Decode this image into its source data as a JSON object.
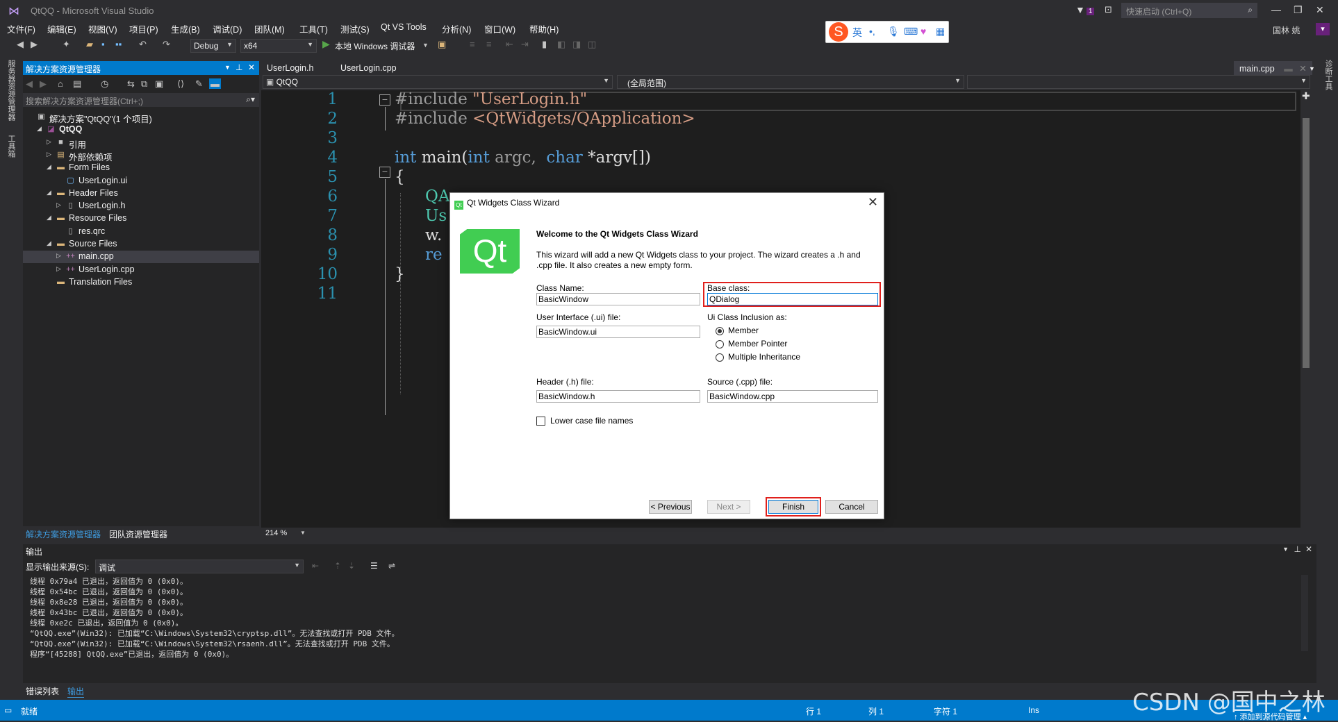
{
  "window": {
    "title": "QtQQ - Microsoft Visual Studio",
    "quick_launch": "快速启动 (Ctrl+Q)",
    "user": "国林 姚",
    "notif_count": "1"
  },
  "menu": [
    "文件(F)",
    "编辑(E)",
    "视图(V)",
    "项目(P)",
    "生成(B)",
    "调试(D)",
    "团队(M)",
    "工具(T)",
    "测试(S)",
    "Qt VS Tools",
    "分析(N)",
    "窗口(W)",
    "帮助(H)"
  ],
  "ime": {
    "mode": "英"
  },
  "toolbar": {
    "config": "Debug",
    "platform": "x64",
    "run_label": "本地 Windows 调试器"
  },
  "leftstrip": [
    "服务器资源管理器",
    "工具箱"
  ],
  "rightstrip": [
    "诊断工具"
  ],
  "solution": {
    "header": "解决方案资源管理器",
    "search_placeholder": "搜索解决方案资源管理器(Ctrl+;)",
    "tree": [
      {
        "label": "解决方案\"QtQQ\"(1 个项目)",
        "indent": 0,
        "arrow": "",
        "icon": "solution-icon"
      },
      {
        "label": "QtQQ",
        "indent": 1,
        "arrow": "◢",
        "icon": "project-icon",
        "bold": true
      },
      {
        "label": "引用",
        "indent": 2,
        "arrow": "▷",
        "icon": "references-icon"
      },
      {
        "label": "外部依赖项",
        "indent": 2,
        "arrow": "▷",
        "icon": "external-deps-icon"
      },
      {
        "label": "Form Files",
        "indent": 2,
        "arrow": "◢",
        "icon": "folder-icon"
      },
      {
        "label": "UserLogin.ui",
        "indent": 3,
        "arrow": "",
        "icon": "ui-file-icon"
      },
      {
        "label": "Header Files",
        "indent": 2,
        "arrow": "◢",
        "icon": "folder-icon"
      },
      {
        "label": "UserLogin.h",
        "indent": 3,
        "arrow": "▷",
        "icon": "header-file-icon"
      },
      {
        "label": "Resource Files",
        "indent": 2,
        "arrow": "◢",
        "icon": "folder-icon"
      },
      {
        "label": "res.qrc",
        "indent": 3,
        "arrow": "",
        "icon": "file-icon"
      },
      {
        "label": "Source Files",
        "indent": 2,
        "arrow": "◢",
        "icon": "folder-icon"
      },
      {
        "label": "main.cpp",
        "indent": 3,
        "arrow": "▷",
        "icon": "cpp-file-icon",
        "selected": true
      },
      {
        "label": "UserLogin.cpp",
        "indent": 3,
        "arrow": "▷",
        "icon": "cpp-file-icon"
      },
      {
        "label": "Translation Files",
        "indent": 2,
        "arrow": "",
        "icon": "folder-icon"
      }
    ],
    "tab_active": "解决方案资源管理器",
    "tab_other": "团队资源管理器"
  },
  "editor": {
    "tabs": [
      "UserLogin.h",
      "UserLogin.cpp"
    ],
    "active_tab": "main.cpp",
    "nav_project": "QtQQ",
    "nav_scope": "(全局范围)",
    "zoom": "214 %",
    "line_numbers": [
      "1",
      "2",
      "3",
      "4",
      "5",
      "6",
      "7",
      "8",
      "9",
      "10",
      "11"
    ],
    "code": {
      "l1_kw": "#include ",
      "l1_str": "\"UserLogin.h\"",
      "l2_kw": "#include ",
      "l2_str": "<QtWidgets/QApplication>",
      "l4_kw": "int",
      "l4_a": " main(",
      "l4_kw2": "int",
      "l4_b": " argc,  ",
      "l4_kw3": "char",
      "l4_c": " *argv[])",
      "l5": "{",
      "l6": "QA",
      "l7": "Us",
      "l8": "w.",
      "l9": "re",
      "l10": "}"
    }
  },
  "output": {
    "title": "输出",
    "source_label": "显示输出来源(S):",
    "source_value": "调试",
    "lines": [
      "线程 0x79a4 已退出，返回值为 0 (0x0)。",
      "线程 0x54bc 已退出，返回值为 0 (0x0)。",
      "线程 0x8e28 已退出，返回值为 0 (0x0)。",
      "线程 0x43bc 已退出，返回值为 0 (0x0)。",
      "线程 0xe2c 已退出，返回值为 0 (0x0)。",
      "“QtQQ.exe”(Win32): 已加载“C:\\Windows\\System32\\cryptsp.dll”。无法查找或打开 PDB 文件。",
      "“QtQQ.exe”(Win32): 已加载“C:\\Windows\\System32\\rsaenh.dll”。无法查找或打开 PDB 文件。",
      "程序“[45288] QtQQ.exe”已退出，返回值为 0 (0x0)。"
    ],
    "tab_errors": "错误列表",
    "tab_output": "输出"
  },
  "status": {
    "ready": "就绪",
    "row": "行 1",
    "col": "列 1",
    "char": "字符 1",
    "ins": "Ins",
    "source_control": "↑ 添加到源代码管理 ▴"
  },
  "watermark": "CSDN @国中之林",
  "dialog": {
    "title": "Qt Widgets Class Wizard",
    "logo_text": "Qt",
    "welcome": "Welcome to the Qt Widgets Class Wizard",
    "description": "This wizard will add a new Qt Widgets class to your project. The wizard creates a .h and .cpp file. It also creates a new empty form.",
    "class_name_label": "Class Name:",
    "class_name_value": "BasicWindow",
    "base_class_label": "Base class:",
    "base_class_value": "QDialog",
    "ui_file_label": "User Interface (.ui) file:",
    "ui_file_value": "BasicWindow.ui",
    "inclusion_label": "Ui Class Inclusion as:",
    "inclusion_options": [
      "Member",
      "Member Pointer",
      "Multiple Inheritance"
    ],
    "inclusion_selected": "Member",
    "header_label": "Header (.h) file:",
    "header_value": "BasicWindow.h",
    "source_label": "Source (.cpp) file:",
    "source_value": "BasicWindow.cpp",
    "lowercase_label": "Lower case file names",
    "lowercase_checked": false,
    "btn_previous": "< Previous",
    "btn_next": "Next >",
    "btn_finish": "Finish",
    "btn_cancel": "Cancel"
  }
}
